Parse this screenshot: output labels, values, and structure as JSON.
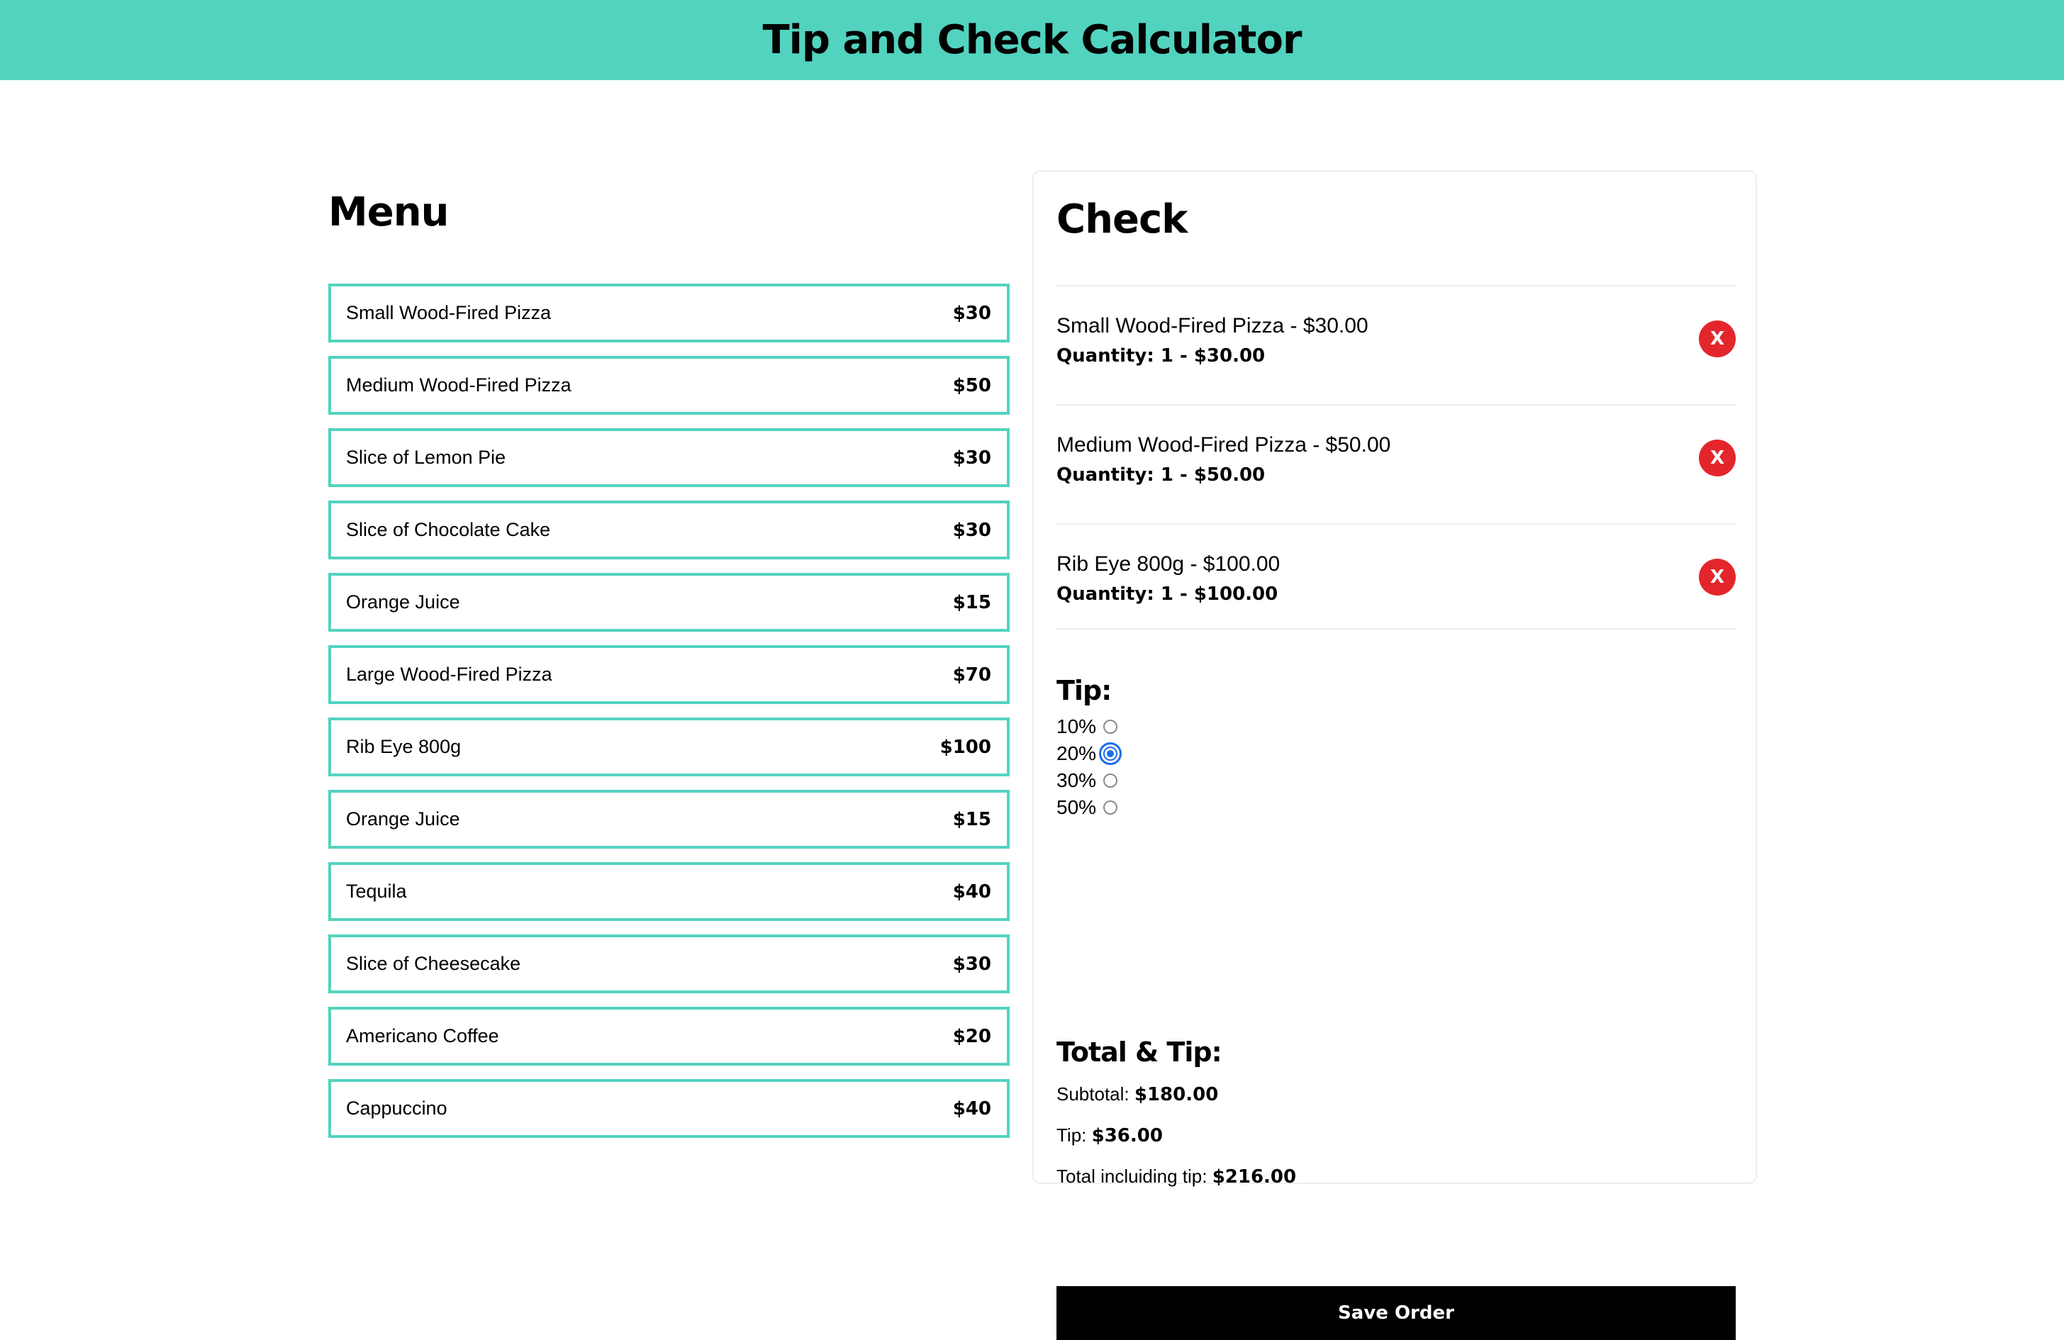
{
  "app": {
    "title": "Tip and Check Calculator"
  },
  "colors": {
    "accent": "#52d3bf",
    "remove": "#e3262c",
    "radio_selected": "#1a6fe8",
    "button": "#000000"
  },
  "menu": {
    "title": "Menu",
    "items": [
      {
        "name": "Small Wood-Fired Pizza",
        "price": "$30"
      },
      {
        "name": "Medium Wood-Fired Pizza",
        "price": "$50"
      },
      {
        "name": "Slice of Lemon Pie",
        "price": "$30"
      },
      {
        "name": "Slice of Chocolate Cake",
        "price": "$30"
      },
      {
        "name": "Orange Juice",
        "price": "$15"
      },
      {
        "name": "Large Wood-Fired Pizza",
        "price": "$70"
      },
      {
        "name": "Rib Eye 800g",
        "price": "$100"
      },
      {
        "name": "Orange Juice",
        "price": "$15"
      },
      {
        "name": "Tequila",
        "price": "$40"
      },
      {
        "name": "Slice of Cheesecake",
        "price": "$30"
      },
      {
        "name": "Americano Coffee",
        "price": "$20"
      },
      {
        "name": "Cappuccino",
        "price": "$40"
      }
    ]
  },
  "check": {
    "title": "Check",
    "remove_label": "X",
    "items": [
      {
        "line": "Small Wood-Fired Pizza - $30.00",
        "quantity": "Quantity: 1 - $30.00"
      },
      {
        "line": "Medium Wood-Fired Pizza - $50.00",
        "quantity": "Quantity: 1 - $50.00"
      },
      {
        "line": "Rib Eye 800g - $100.00",
        "quantity": "Quantity: 1 - $100.00"
      }
    ]
  },
  "tip": {
    "title": "Tip:",
    "options": [
      {
        "label": "10%",
        "selected": false
      },
      {
        "label": "20%",
        "selected": true
      },
      {
        "label": "30%",
        "selected": false
      },
      {
        "label": "50%",
        "selected": false
      }
    ]
  },
  "totals": {
    "title": "Total & Tip:",
    "subtotal_label": "Subtotal:",
    "subtotal_value": "$180.00",
    "tip_label": "Tip:",
    "tip_value": "$36.00",
    "total_label": "Total incluiding tip:",
    "total_value": "$216.00"
  },
  "save_button": {
    "label": "Save Order"
  }
}
